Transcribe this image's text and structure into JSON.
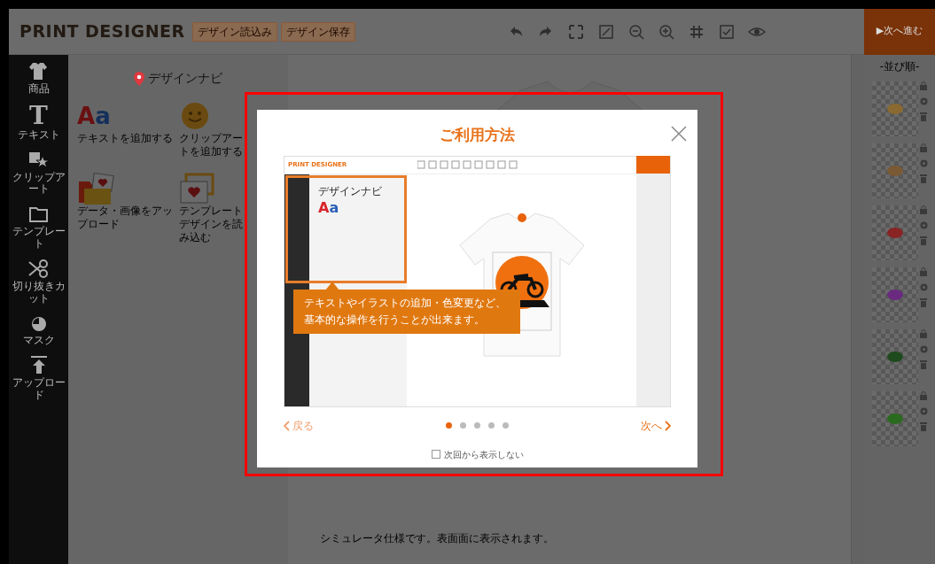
{
  "header": {
    "logo": "PRINT DESIGNER",
    "buttons": [
      "デザイン読込み",
      "デザイン保存"
    ],
    "next_button": "▶次へ進む"
  },
  "sidebar": {
    "items": [
      {
        "kind": "shirt",
        "label": "商品"
      },
      {
        "kind": "text",
        "glyph": "T",
        "label": "テキスト"
      },
      {
        "kind": "clipart",
        "label": "クリップアート"
      },
      {
        "kind": "template",
        "label": "テンプレート"
      },
      {
        "kind": "cut",
        "label": "切り抜きカット"
      },
      {
        "kind": "mask",
        "label": "マスク"
      },
      {
        "kind": "upload",
        "label": "アップロード"
      }
    ]
  },
  "design_navi": {
    "title": "デザインナビ",
    "items": [
      {
        "kind": "text",
        "glyph": "Aa",
        "label": "テキストを追加する"
      },
      {
        "kind": "clipart",
        "label": "クリップアートを追加する"
      },
      {
        "kind": "upload",
        "label": "データ・画像をアップロード"
      },
      {
        "kind": "template",
        "label": "テンプレートデザインを読み込む"
      }
    ]
  },
  "canvas": {
    "note": "シミュレータ仕様です。表面面に表示されます。"
  },
  "layers": {
    "title": "-並び順-",
    "items": [
      {
        "color": "#8a6a30"
      },
      {
        "color": "#7a5a34"
      },
      {
        "color": "#8a2424"
      },
      {
        "color": "#6a2a80"
      },
      {
        "color": "#1e4a1e"
      },
      {
        "color": "#2a6a1e"
      }
    ]
  },
  "modal": {
    "title": "ご利用方法",
    "tutorial": {
      "logo": "PRINT DESIGNER",
      "navi_title": "デザインナビ",
      "glyph": "Aa",
      "tooltip": "テキストやイラストの追加・色変更など、基本的な操作を行うことが出来ます。"
    },
    "prev": "戻る",
    "next": "次へ",
    "pages": [
      {
        "selected": true
      },
      {
        "selected": false
      },
      {
        "selected": false
      },
      {
        "selected": false
      },
      {
        "selected": false
      }
    ],
    "dont_show": {
      "label": "次回から表示しない",
      "checked": false
    }
  }
}
